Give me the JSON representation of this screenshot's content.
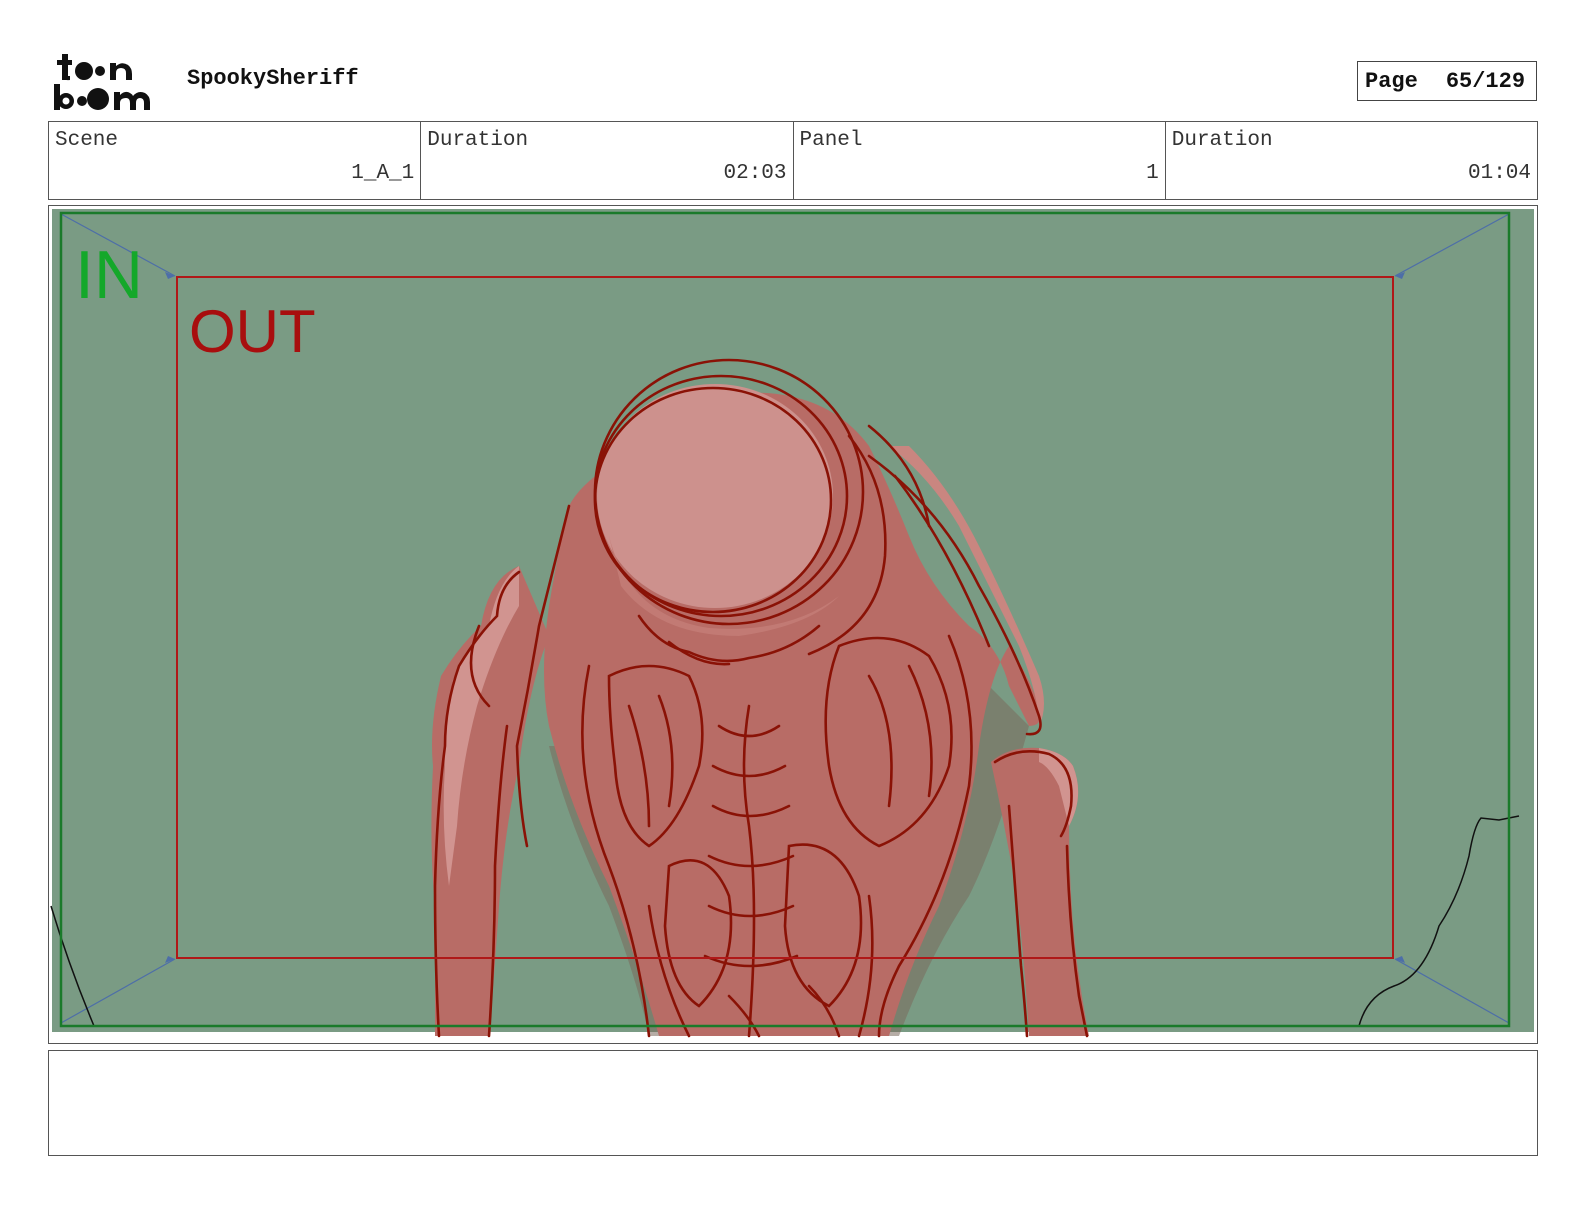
{
  "header": {
    "logo_alt": "toon boom",
    "project_title": "SpookySheriff",
    "page_label": "Page",
    "page_number": "65/129"
  },
  "info": {
    "scene_label": "Scene",
    "scene_value": "1_A_1",
    "scene_duration_label": "Duration",
    "scene_duration_value": "02:03",
    "panel_label": "Panel",
    "panel_value": "1",
    "panel_duration_label": "Duration",
    "panel_duration_value": "01:04"
  },
  "panel": {
    "in_label": "IN",
    "out_label": "OUT",
    "colors": {
      "background": "#7a9b84",
      "in_frame": "#1a7a2a",
      "in_text": "#14a82a",
      "out_frame": "#b01818",
      "out_text": "#a80e0e",
      "figure_fill": "#b86c66",
      "figure_highlight": "#d19490",
      "figure_line": "#8a1206"
    }
  },
  "notes": {
    "text": ""
  }
}
